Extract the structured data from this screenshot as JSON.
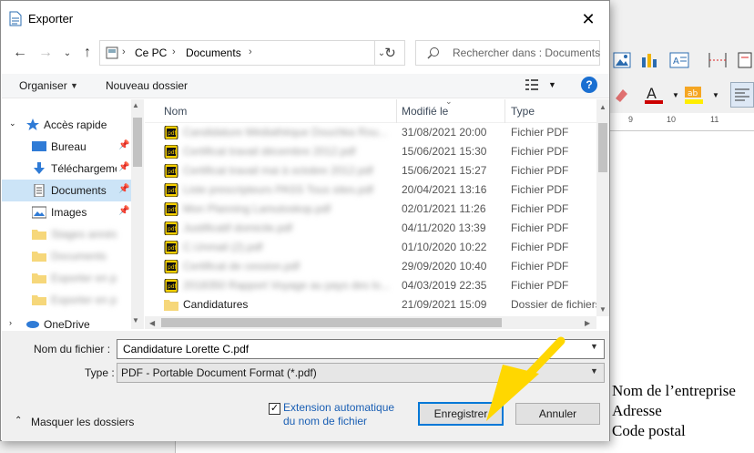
{
  "dialog": {
    "title": "Exporter",
    "breadcrumbs": [
      "Ce PC",
      "Documents"
    ],
    "search_placeholder": "Rechercher dans : Documents",
    "commands": {
      "organize": "Organiser",
      "new_folder": "Nouveau dossier",
      "help": "?"
    },
    "nav_pane": {
      "items": [
        {
          "label": "Accès rapide",
          "icon": "star-icon"
        },
        {
          "label": "Bureau",
          "icon": "desktop-icon",
          "pinned": true
        },
        {
          "label": "Téléchargements",
          "icon": "download-icon",
          "pinned": true
        },
        {
          "label": "Documents",
          "icon": "document-icon",
          "pinned": true,
          "selected": true
        },
        {
          "label": "Images",
          "icon": "images-icon",
          "pinned": true
        },
        {
          "label": "Stages annés",
          "icon": "folder-icon"
        },
        {
          "label": "Documents",
          "icon": "folder-icon"
        },
        {
          "label": "Exporter en pdf",
          "icon": "folder-icon"
        },
        {
          "label": "Exporter en pdf",
          "icon": "folder-icon"
        },
        {
          "label": "OneDrive",
          "icon": "cloud-icon"
        }
      ]
    },
    "columns": {
      "name": "Nom",
      "modified": "Modifié le",
      "type": "Type"
    },
    "files": [
      {
        "name": "Candidature Médiathèque Douchka Rou...",
        "modified": "31/08/2021 20:00",
        "type": "Fichier PDF",
        "icon": "pdf-icon"
      },
      {
        "name": "Certificat travail décembre 2012.pdf",
        "modified": "15/06/2021 15:30",
        "type": "Fichier PDF",
        "icon": "pdf-icon"
      },
      {
        "name": "Certificat travail mai à octobre 2012.pdf",
        "modified": "15/06/2021 15:27",
        "type": "Fichier PDF",
        "icon": "pdf-icon"
      },
      {
        "name": "Liste prescripteurs PASS Tous sites.pdf",
        "modified": "20/04/2021 13:16",
        "type": "Fichier PDF",
        "icon": "pdf-icon"
      },
      {
        "name": "Mon Planning Lamutoskop.pdf",
        "modified": "02/01/2021 11:26",
        "type": "Fichier PDF",
        "icon": "pdf-icon"
      },
      {
        "name": "Justificatif domicile.pdf",
        "modified": "04/11/2020 13:39",
        "type": "Fichier PDF",
        "icon": "pdf-icon"
      },
      {
        "name": "C.Unmail (2).pdf",
        "modified": "01/10/2020 10:22",
        "type": "Fichier PDF",
        "icon": "pdf-icon"
      },
      {
        "name": "Certificat de cession.pdf",
        "modified": "29/09/2020 10:40",
        "type": "Fichier PDF",
        "icon": "pdf-icon"
      },
      {
        "name": "2018350 Rapport Voyage au pays des lo...",
        "modified": "04/03/2019 22:35",
        "type": "Fichier PDF",
        "icon": "pdf-icon"
      },
      {
        "name": "Candidatures",
        "modified": "21/09/2021 15:09",
        "type": "Dossier de fichiers",
        "icon": "folder-icon"
      }
    ],
    "form": {
      "filename_label": "Nom du fichier :",
      "filename_value": "Candidature Lorette C.pdf",
      "type_label": "Type :",
      "type_value": "PDF - Portable Document Format (*.pdf)",
      "ext_auto_line1": "Extension automatique",
      "ext_auto_line2": "du nom de fichier",
      "ext_auto_checked": true,
      "save": "Enregistrer",
      "cancel": "Annuler",
      "hide_folders": "Masquer les dossiers"
    }
  },
  "background_doc": {
    "lines": [
      "Nom de l’entreprise",
      "Adresse",
      "Code postal"
    ],
    "ruler_ticks": [
      "9",
      "10",
      "11"
    ]
  },
  "colors": {
    "accent": "#0078d7",
    "selection": "#cce4f7",
    "annotation_arrow": "#ffd700"
  }
}
